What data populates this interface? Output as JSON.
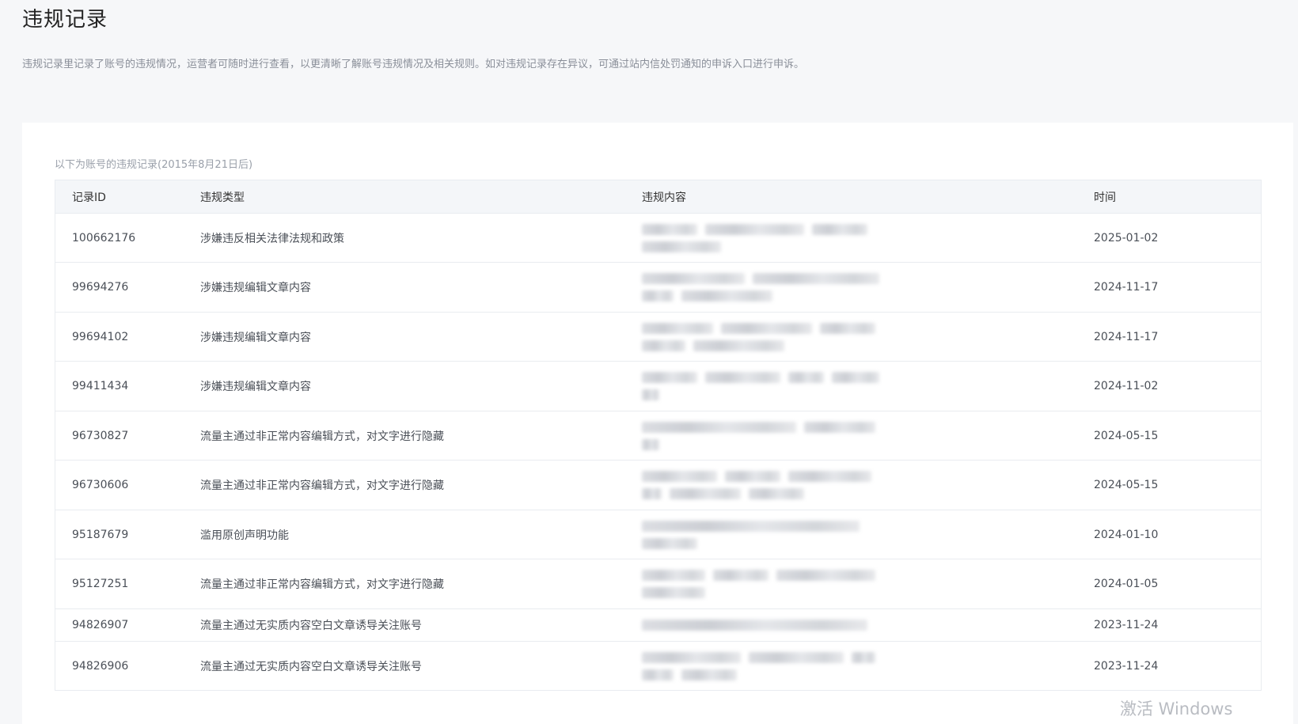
{
  "page": {
    "title": "违规记录",
    "description": "违规记录里记录了账号的违规情况，运营者可随时进行查看，以更清晰了解账号违规情况及相关规则。如对违规记录存在异议，可通过站内信处罚通知的申诉入口进行申诉。"
  },
  "panel": {
    "caption": "以下为账号的违规记录(2015年8月21日后)"
  },
  "table": {
    "headers": {
      "id": "记录ID",
      "type": "违规类型",
      "content": "违规内容",
      "time": "时间"
    },
    "rows": [
      {
        "id": "100662176",
        "type": "涉嫌违反相关法律法规和政策",
        "time": "2025-01-02"
      },
      {
        "id": "99694276",
        "type": "涉嫌违规编辑文章内容",
        "time": "2024-11-17"
      },
      {
        "id": "99694102",
        "type": "涉嫌违规编辑文章内容",
        "time": "2024-11-17"
      },
      {
        "id": "99411434",
        "type": "涉嫌违规编辑文章内容",
        "time": "2024-11-02"
      },
      {
        "id": "96730827",
        "type": "流量主通过非正常内容编辑方式，对文字进行隐藏",
        "time": "2024-05-15"
      },
      {
        "id": "96730606",
        "type": "流量主通过非正常内容编辑方式，对文字进行隐藏",
        "time": "2024-05-15"
      },
      {
        "id": "95187679",
        "type": "滥用原创声明功能",
        "time": "2024-01-10"
      },
      {
        "id": "95127251",
        "type": "流量主通过非正常内容编辑方式，对文字进行隐藏",
        "time": "2024-01-05"
      },
      {
        "id": "94826907",
        "type": "流量主通过无实质内容空白文章诱导关注账号",
        "time": "2023-11-24"
      },
      {
        "id": "94826906",
        "type": "流量主通过无实质内容空白文章诱导关注账号",
        "time": "2023-11-24"
      }
    ]
  },
  "watermark": "激活 Windows"
}
